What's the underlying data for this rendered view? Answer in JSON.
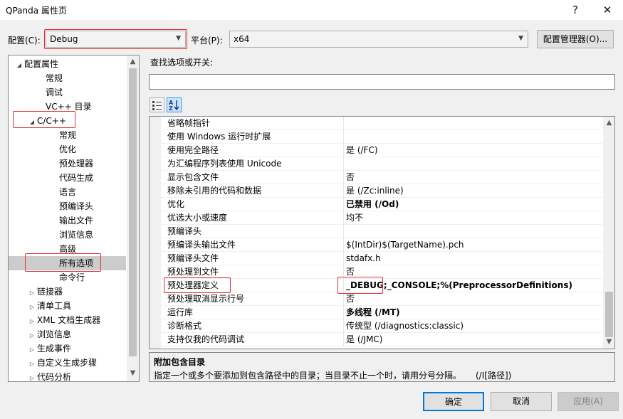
{
  "window": {
    "title": "QPanda 属性页",
    "help": "?",
    "close": "✕"
  },
  "config": {
    "label": "配置(C):",
    "value": "Debug",
    "platform_label": "平台(P):",
    "platform_value": "x64",
    "manager_button": "配置管理器(O)..."
  },
  "search": {
    "label": "查找选项或开关:",
    "value": ""
  },
  "tree": [
    {
      "label": "配置属性",
      "level": 0,
      "arrow": "◢",
      "expanded": true
    },
    {
      "label": "常规",
      "level": 2
    },
    {
      "label": "调试",
      "level": 2
    },
    {
      "label": "VC++ 目录",
      "level": 2
    },
    {
      "label": "C/C++",
      "level": 1,
      "arrow": "◢",
      "expanded": true
    },
    {
      "label": "常规",
      "level": 3
    },
    {
      "label": "优化",
      "level": 3
    },
    {
      "label": "预处理器",
      "level": 3
    },
    {
      "label": "代码生成",
      "level": 3
    },
    {
      "label": "语言",
      "level": 3
    },
    {
      "label": "预编译头",
      "level": 3
    },
    {
      "label": "输出文件",
      "level": 3
    },
    {
      "label": "浏览信息",
      "level": 3
    },
    {
      "label": "高级",
      "level": 3
    },
    {
      "label": "所有选项",
      "level": 3,
      "selected": true
    },
    {
      "label": "命令行",
      "level": 3
    },
    {
      "label": "链接器",
      "level": 1,
      "arrow": "▷"
    },
    {
      "label": "清单工具",
      "level": 1,
      "arrow": "▷"
    },
    {
      "label": "XML 文档生成器",
      "level": 1,
      "arrow": "▷"
    },
    {
      "label": "浏览信息",
      "level": 1,
      "arrow": "▷"
    },
    {
      "label": "生成事件",
      "level": 1,
      "arrow": "▷"
    },
    {
      "label": "自定义生成步骤",
      "level": 1,
      "arrow": "▷"
    },
    {
      "label": "代码分析",
      "level": 1,
      "arrow": "▷"
    }
  ],
  "properties": [
    {
      "name": "省略帧指针",
      "value": ""
    },
    {
      "name": "使用 Windows 运行时扩展",
      "value": ""
    },
    {
      "name": "使用完全路径",
      "value": "是 (/FC)"
    },
    {
      "name": "为汇编程序列表使用 Unicode",
      "value": ""
    },
    {
      "name": "显示包含文件",
      "value": "否"
    },
    {
      "name": "移除未引用的代码和数据",
      "value": "是 (/Zc:inline)"
    },
    {
      "name": "优化",
      "value": "已禁用 (/Od)",
      "bold": true
    },
    {
      "name": "优选大小或速度",
      "value": "均不"
    },
    {
      "name": "预编译头",
      "value": ""
    },
    {
      "name": "预编译头输出文件",
      "value": "$(IntDir)$(TargetName).pch"
    },
    {
      "name": "预编译头文件",
      "value": "stdafx.h"
    },
    {
      "name": "预处理到文件",
      "value": "否"
    },
    {
      "name": "预处理器定义",
      "value": "_DEBUG;_CONSOLE;%(PreprocessorDefinitions)",
      "bold": true
    },
    {
      "name": "预处理取消显示行号",
      "value": "否"
    },
    {
      "name": "运行库",
      "value": "多线程 (/MT)",
      "bold": true
    },
    {
      "name": "诊断格式",
      "value": "传统型 (/diagnostics:classic)"
    },
    {
      "name": "支持仅我的代码调试",
      "value": "是 (/JMC)"
    }
  ],
  "description": {
    "title": "附加包含目录",
    "text": "指定一个或多个要添加到包含路径中的目录；当目录不止一个时，请用分号分隔。",
    "switch": "(/I[路径])"
  },
  "buttons": {
    "ok": "确定",
    "cancel": "取消",
    "apply": "应用(A)"
  },
  "colors": {
    "highlight_box": "#e03030",
    "selection": "#cccccc",
    "default_button_border": "#0078d7"
  }
}
